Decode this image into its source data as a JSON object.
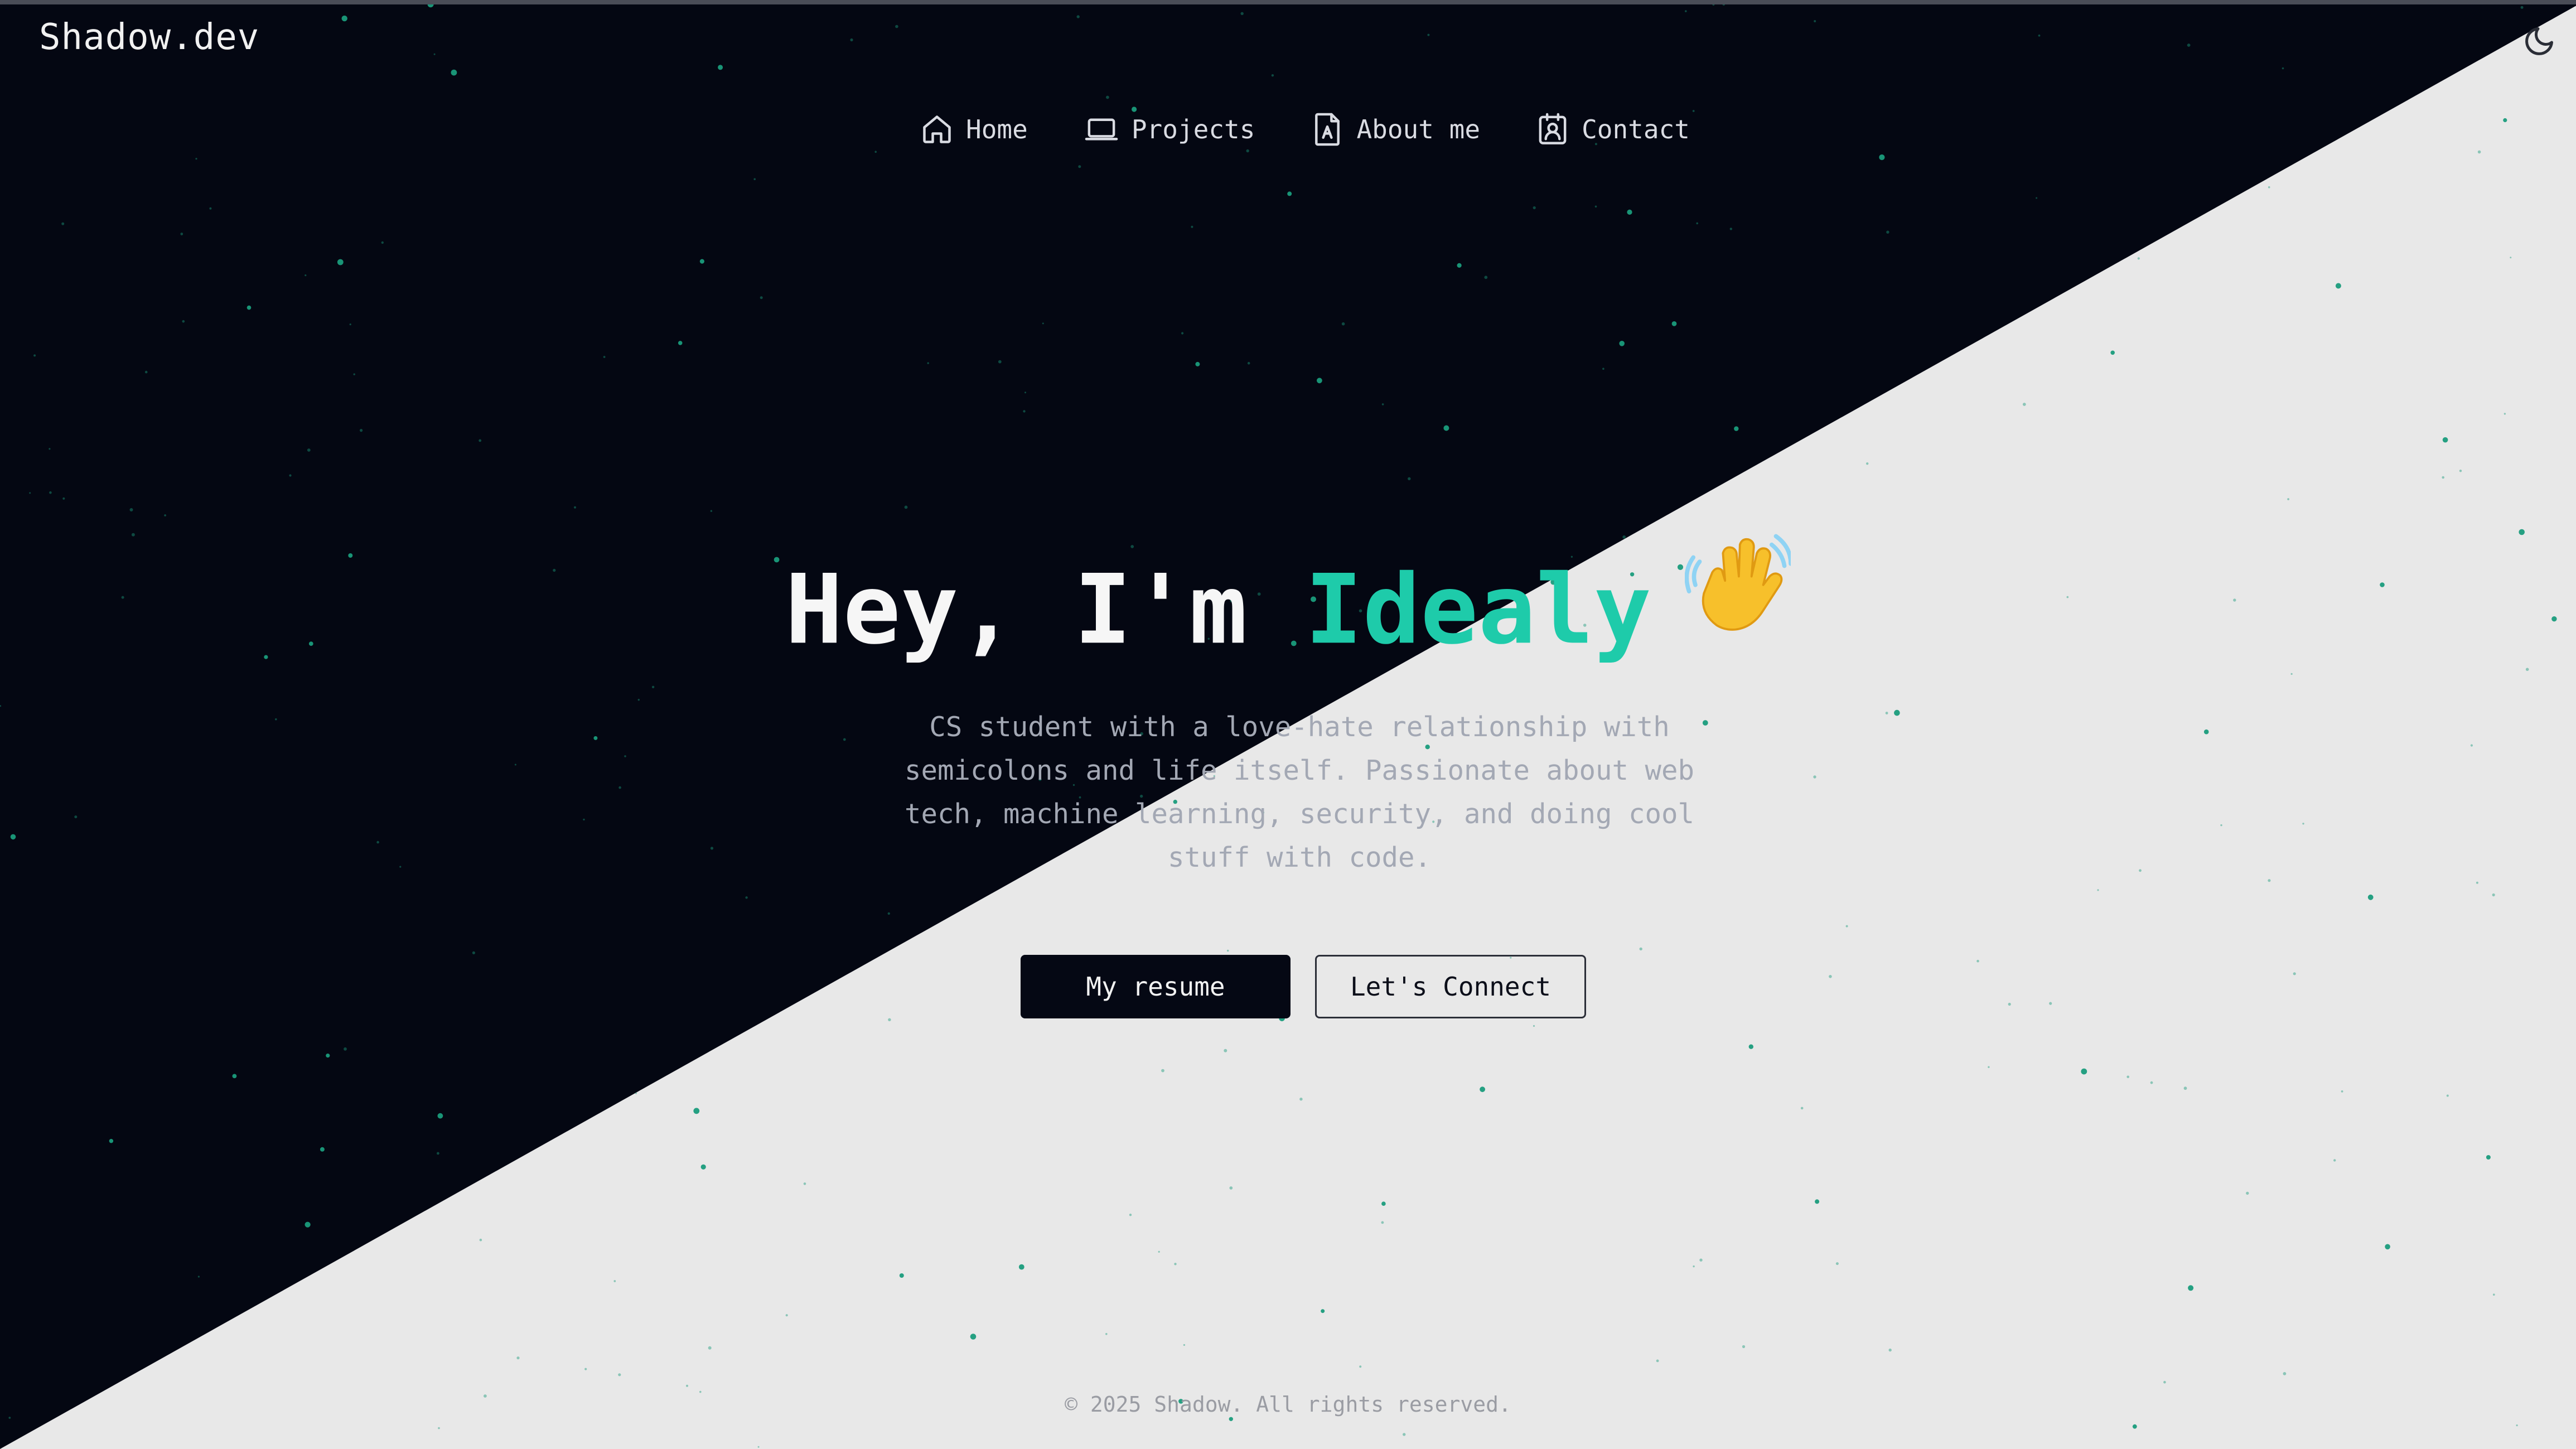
{
  "header": {
    "logo": "Shadow.dev",
    "theme_toggle_icon": "moon-icon"
  },
  "nav": {
    "items": [
      {
        "label": "Home",
        "icon": "home-icon"
      },
      {
        "label": "Projects",
        "icon": "laptop-icon"
      },
      {
        "label": "About me",
        "icon": "document-icon"
      },
      {
        "label": "Contact",
        "icon": "contact-card-icon"
      }
    ]
  },
  "hero": {
    "greeting": "Hey, I'm ",
    "name": "Idealy",
    "wave_emoji": "👋",
    "description": "CS student with a love-hate relationship with semicolons and life itself. Passionate about web tech, machine learning, security, and doing cool stuff with code.",
    "buttons": {
      "resume": "My resume",
      "connect": "Let's Connect"
    }
  },
  "footer": {
    "copyright": "© 2025 Shadow. All rights reserved."
  },
  "colors": {
    "dark_bg": "#040712",
    "light_bg": "#e8e8e8",
    "accent": "#1ecbaa",
    "star": "#1a9c7c"
  }
}
